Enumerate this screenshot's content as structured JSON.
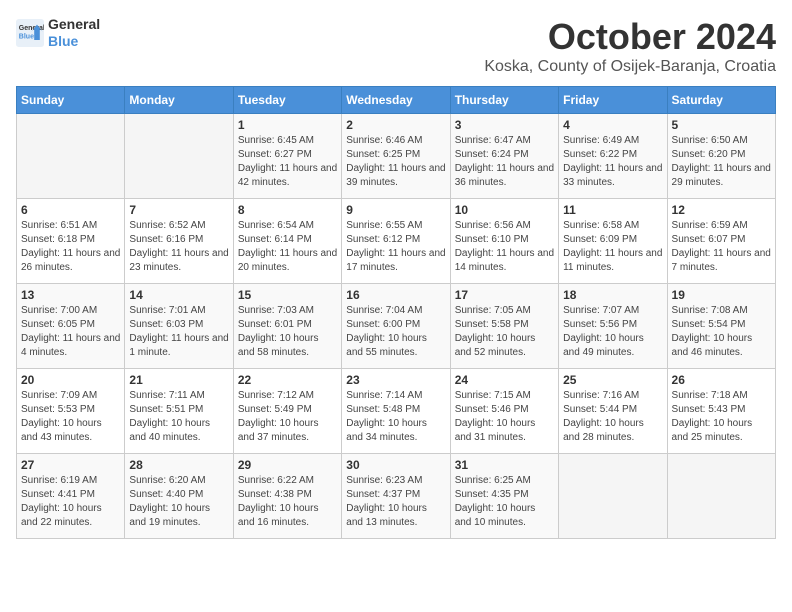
{
  "header": {
    "logo_line1": "General",
    "logo_line2": "Blue",
    "month_title": "October 2024",
    "subtitle": "Koska, County of Osijek-Baranja, Croatia"
  },
  "days_of_week": [
    "Sunday",
    "Monday",
    "Tuesday",
    "Wednesday",
    "Thursday",
    "Friday",
    "Saturday"
  ],
  "weeks": [
    [
      {
        "day": null
      },
      {
        "day": null
      },
      {
        "day": "1",
        "sunrise": "6:45 AM",
        "sunset": "6:27 PM",
        "daylight": "11 hours and 42 minutes."
      },
      {
        "day": "2",
        "sunrise": "6:46 AM",
        "sunset": "6:25 PM",
        "daylight": "11 hours and 39 minutes."
      },
      {
        "day": "3",
        "sunrise": "6:47 AM",
        "sunset": "6:24 PM",
        "daylight": "11 hours and 36 minutes."
      },
      {
        "day": "4",
        "sunrise": "6:49 AM",
        "sunset": "6:22 PM",
        "daylight": "11 hours and 33 minutes."
      },
      {
        "day": "5",
        "sunrise": "6:50 AM",
        "sunset": "6:20 PM",
        "daylight": "11 hours and 29 minutes."
      }
    ],
    [
      {
        "day": "6",
        "sunrise": "6:51 AM",
        "sunset": "6:18 PM",
        "daylight": "11 hours and 26 minutes."
      },
      {
        "day": "7",
        "sunrise": "6:52 AM",
        "sunset": "6:16 PM",
        "daylight": "11 hours and 23 minutes."
      },
      {
        "day": "8",
        "sunrise": "6:54 AM",
        "sunset": "6:14 PM",
        "daylight": "11 hours and 20 minutes."
      },
      {
        "day": "9",
        "sunrise": "6:55 AM",
        "sunset": "6:12 PM",
        "daylight": "11 hours and 17 minutes."
      },
      {
        "day": "10",
        "sunrise": "6:56 AM",
        "sunset": "6:10 PM",
        "daylight": "11 hours and 14 minutes."
      },
      {
        "day": "11",
        "sunrise": "6:58 AM",
        "sunset": "6:09 PM",
        "daylight": "11 hours and 11 minutes."
      },
      {
        "day": "12",
        "sunrise": "6:59 AM",
        "sunset": "6:07 PM",
        "daylight": "11 hours and 7 minutes."
      }
    ],
    [
      {
        "day": "13",
        "sunrise": "7:00 AM",
        "sunset": "6:05 PM",
        "daylight": "11 hours and 4 minutes."
      },
      {
        "day": "14",
        "sunrise": "7:01 AM",
        "sunset": "6:03 PM",
        "daylight": "11 hours and 1 minute."
      },
      {
        "day": "15",
        "sunrise": "7:03 AM",
        "sunset": "6:01 PM",
        "daylight": "10 hours and 58 minutes."
      },
      {
        "day": "16",
        "sunrise": "7:04 AM",
        "sunset": "6:00 PM",
        "daylight": "10 hours and 55 minutes."
      },
      {
        "day": "17",
        "sunrise": "7:05 AM",
        "sunset": "5:58 PM",
        "daylight": "10 hours and 52 minutes."
      },
      {
        "day": "18",
        "sunrise": "7:07 AM",
        "sunset": "5:56 PM",
        "daylight": "10 hours and 49 minutes."
      },
      {
        "day": "19",
        "sunrise": "7:08 AM",
        "sunset": "5:54 PM",
        "daylight": "10 hours and 46 minutes."
      }
    ],
    [
      {
        "day": "20",
        "sunrise": "7:09 AM",
        "sunset": "5:53 PM",
        "daylight": "10 hours and 43 minutes."
      },
      {
        "day": "21",
        "sunrise": "7:11 AM",
        "sunset": "5:51 PM",
        "daylight": "10 hours and 40 minutes."
      },
      {
        "day": "22",
        "sunrise": "7:12 AM",
        "sunset": "5:49 PM",
        "daylight": "10 hours and 37 minutes."
      },
      {
        "day": "23",
        "sunrise": "7:14 AM",
        "sunset": "5:48 PM",
        "daylight": "10 hours and 34 minutes."
      },
      {
        "day": "24",
        "sunrise": "7:15 AM",
        "sunset": "5:46 PM",
        "daylight": "10 hours and 31 minutes."
      },
      {
        "day": "25",
        "sunrise": "7:16 AM",
        "sunset": "5:44 PM",
        "daylight": "10 hours and 28 minutes."
      },
      {
        "day": "26",
        "sunrise": "7:18 AM",
        "sunset": "5:43 PM",
        "daylight": "10 hours and 25 minutes."
      }
    ],
    [
      {
        "day": "27",
        "sunrise": "6:19 AM",
        "sunset": "4:41 PM",
        "daylight": "10 hours and 22 minutes."
      },
      {
        "day": "28",
        "sunrise": "6:20 AM",
        "sunset": "4:40 PM",
        "daylight": "10 hours and 19 minutes."
      },
      {
        "day": "29",
        "sunrise": "6:22 AM",
        "sunset": "4:38 PM",
        "daylight": "10 hours and 16 minutes."
      },
      {
        "day": "30",
        "sunrise": "6:23 AM",
        "sunset": "4:37 PM",
        "daylight": "10 hours and 13 minutes."
      },
      {
        "day": "31",
        "sunrise": "6:25 AM",
        "sunset": "4:35 PM",
        "daylight": "10 hours and 10 minutes."
      },
      {
        "day": null
      },
      {
        "day": null
      }
    ]
  ]
}
